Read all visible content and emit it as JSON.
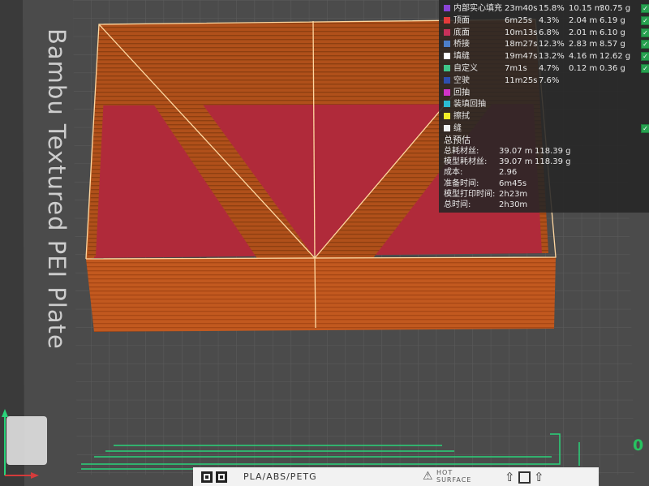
{
  "viewport": {
    "plate_label": "Bambu Textured PEI Plate",
    "colors": {
      "plate": "#4a4a4a",
      "grid": "#5b5b5b",
      "wall": "#c0581e",
      "inner_fill": "#b02a3a",
      "highlight": "#ffd7a0",
      "travel": "#2ad37a"
    }
  },
  "stats": {
    "feature_rows": [
      {
        "name": "内部实心填充",
        "time": "23m40s",
        "percent": "15.8%",
        "length": "10.15 m",
        "weight": "30.75 g",
        "color": "#8a44d6",
        "checked": true
      },
      {
        "name": "顶面",
        "time": "6m25s",
        "percent": "4.3%",
        "length": "2.04 m",
        "weight": "6.19 g",
        "color": "#e53b3b",
        "checked": true
      },
      {
        "name": "底面",
        "time": "10m13s",
        "percent": "6.8%",
        "length": "2.01 m",
        "weight": "6.10 g",
        "color": "#c8315a",
        "checked": true
      },
      {
        "name": "桥接",
        "time": "18m27s",
        "percent": "12.3%",
        "length": "2.83 m",
        "weight": "8.57 g",
        "color": "#4d7ec8",
        "checked": true
      },
      {
        "name": "填缝",
        "time": "19m47s",
        "percent": "13.2%",
        "length": "4.16 m",
        "weight": "12.62 g",
        "color": "#ffffff",
        "checked": true
      },
      {
        "name": "自定义",
        "time": "7m1s",
        "percent": "4.7%",
        "length": "0.12 m",
        "weight": "0.36 g",
        "color": "#3fc68a",
        "checked": true
      },
      {
        "name": "空驶",
        "time": "11m25s",
        "percent": "7.6%",
        "length": "",
        "weight": "",
        "color": "#2e4fb0",
        "checked": false
      },
      {
        "name": "回抽",
        "time": "",
        "percent": "",
        "length": "",
        "weight": "",
        "color": "#d133c9",
        "checked": false
      },
      {
        "name": "装填回抽",
        "time": "",
        "percent": "",
        "length": "",
        "weight": "",
        "color": "#2bbbd4",
        "checked": false
      },
      {
        "name": "擦拭",
        "time": "",
        "percent": "",
        "length": "",
        "weight": "",
        "color": "#f2ee28",
        "checked": false
      },
      {
        "name": "缝",
        "time": "",
        "percent": "",
        "length": "",
        "weight": "",
        "color": "#f0f0f0",
        "checked": true
      }
    ],
    "summary_title": "总预估",
    "summary_rows": [
      {
        "key": "总耗材丝:",
        "v1": "39.07 m",
        "v2": "118.39 g"
      },
      {
        "key": "模型耗材丝:",
        "v1": "39.07 m",
        "v2": "118.39 g"
      },
      {
        "key": "成本:",
        "v1": "2.96",
        "v2": ""
      },
      {
        "key": "准备时间:",
        "v1": "6m45s",
        "v2": ""
      },
      {
        "key": "模型打印时间:",
        "v1": "2h23m",
        "v2": ""
      },
      {
        "key": "总时间:",
        "v1": "2h30m",
        "v2": ""
      }
    ]
  },
  "bottom_strip": {
    "filament_compat": "PLA/ABS/PETG",
    "hot_surface_line1": "HOT",
    "hot_surface_line2": "SURFACE",
    "arrow_glyph": "⇧",
    "hot_glyph": "⚠"
  },
  "right_readout": "0"
}
